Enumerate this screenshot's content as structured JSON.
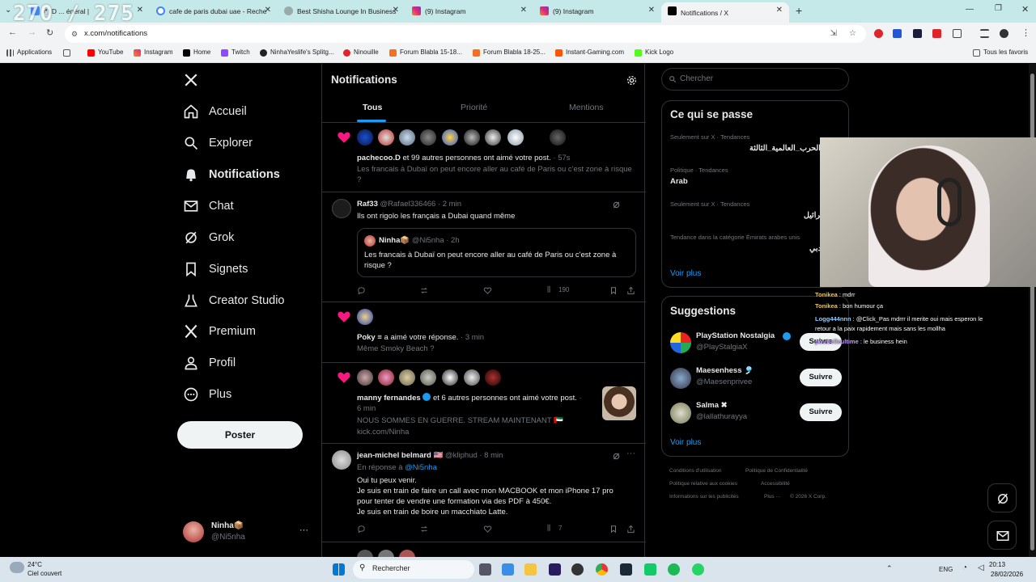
{
  "overlay_counter": "270 / 275",
  "tabs": [
    {
      "label": "4) D ... énéral |"
    },
    {
      "label": "cafe de paris dubai uae - Reche"
    },
    {
      "label": "Best Shisha Lounge In Business"
    },
    {
      "label": "(9) Instagram"
    },
    {
      "label": "(9) Instagram"
    },
    {
      "label": "Notifications / X"
    }
  ],
  "url": "x.com/notifications",
  "bookmarks": [
    "Applications",
    "YouTube",
    "Instagram",
    "Home",
    "Twitch",
    "NinhaYeslife's Splitg...",
    "Ninouille",
    "Forum Blabla 15-18...",
    "Forum Blabla 18-25...",
    "Instant-Gaming.com",
    "Kick Logo"
  ],
  "bookmarks_all": "Tous les favoris",
  "nav": {
    "home": "Accueil",
    "explore": "Explorer",
    "notifications": "Notifications",
    "chat": "Chat",
    "grok": "Grok",
    "bookmarks": "Signets",
    "creator": "Creator Studio",
    "premium": "Premium",
    "profile": "Profil",
    "more": "Plus",
    "post": "Poster"
  },
  "account": {
    "name": "Ninha📦",
    "handle": "@Ni5nha",
    "more": "···"
  },
  "feed": {
    "title": "Notifications",
    "tabs": [
      "Tous",
      "Priorité",
      "Mentions"
    ],
    "n1": {
      "actor": "pachecoo.D",
      "text": " et 99 autres personnes ont aimé votre post.",
      "time": " · 57s",
      "excerpt": "Les francais à Dubaï on peut encore aller au café de Paris ou c'est zone à risque ?"
    },
    "n2": {
      "name": "Raf33",
      "handle": "@Rafael336466 · 2 min",
      "text": "Ils ont rigolo les français a Dubai quand même",
      "q_name": "Ninha📦",
      "q_handle": "@Ni5nha · 2h",
      "q_text": "Les francais à Dubaï on peut encore aller au café de Paris ou c'est zone à risque ?",
      "views": "190"
    },
    "n3": {
      "actor": "Poky ≡",
      "text": " a aimé votre réponse.",
      "time": " · 3 min",
      "excerpt": "Même Smoky Beach ?"
    },
    "n4": {
      "actor": "manny fernandes",
      "text": " et 6 autres personnes ont aimé votre post.",
      "time": " · 6 min",
      "excerpt1": "NOUS SOMMES EN GUERRE. STREAM MAINTENANT 🇦🇪",
      "excerpt2": "kick.com/Ninha"
    },
    "n5": {
      "name": "jean-michel belmard 🇺🇸",
      "handle": "@kliphud · 8 min",
      "reply_to_prefix": "En réponse à ",
      "reply_to": "@Ni5nha",
      "line1": "Oui tu peux venir.",
      "line2": "Je suis en train de faire un call avec mon MACBOOK et mon iPhone 17 pro",
      "line3": "pour tenter de vendre une formation via des PDF à 450€.",
      "line4": "Je suis en train de boire un macchiato Latte.",
      "views": "7"
    }
  },
  "right": {
    "search_placeholder": "Chercher",
    "trends_title": "Ce qui se passe",
    "trends": [
      {
        "meta": "Seulement sur X · Tendances",
        "name": "الحرب_العالمية_الثالثة"
      },
      {
        "meta": "Politique · Tendances",
        "name": "Arab"
      },
      {
        "meta": "Seulement sur X · Tendances",
        "name": "إسرائيل"
      },
      {
        "meta": "Tendance dans la catégorie Émirats arabes unis",
        "name": "دبي"
      }
    ],
    "see_more": "Voir plus",
    "suggestions_title": "Suggestions",
    "suggestions": [
      {
        "name": "PlayStation Nostalgia",
        "handle": "@PlayStalgiaX",
        "btn": "Suivre"
      },
      {
        "name": "Maesenhess 🎐",
        "handle": "@Maesenprivee",
        "btn": "Suivre"
      },
      {
        "name": "Salma ✖",
        "handle": "@lallathurayya",
        "btn": "Suivre"
      }
    ],
    "see_more2": "Voir plus",
    "footer": [
      "Conditions d'utilisation",
      "Politique de Confidentialité",
      "Politique relative aux cookies",
      "Accessibilité",
      "Informations sur les publicités",
      "Plus ···",
      "© 2026 X Corp."
    ]
  },
  "chat": [
    {
      "user": "Tonikea",
      "msg": " : mdrr"
    },
    {
      "user": "Tonikea",
      "msg": " : bon humour ça"
    },
    {
      "user": "Logg444nnn",
      "msg": " : @Click_Pas mdrrr il merite oui mais esperon le"
    },
    {
      "user": "",
      "msg": "retour a la paix rapidement mais sans les mollha"
    },
    {
      "user": "poutrelleultime",
      "msg": " : le business hein"
    }
  ],
  "taskbar": {
    "weather_temp": "24°C",
    "weather_desc": "Ciel couvert",
    "search": "Rechercher",
    "lang": "ENG",
    "time": "20:13",
    "date": "28/02/2026"
  },
  "colors": {
    "accent": "#1d9bf0",
    "like": "#f91880",
    "bg": "#000000"
  }
}
